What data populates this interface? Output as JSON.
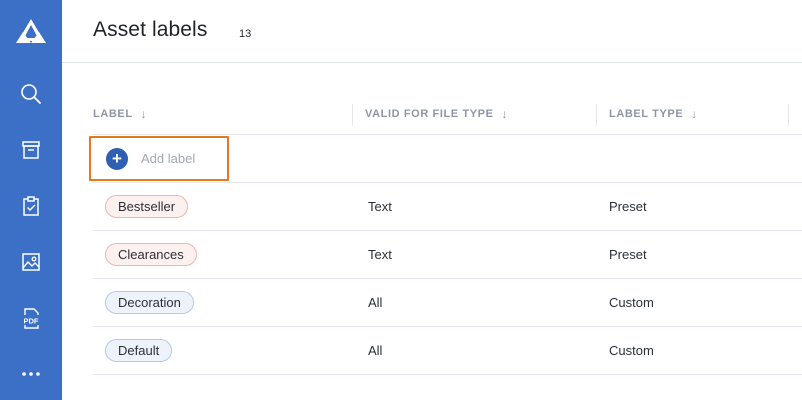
{
  "sidebar": {
    "items": [
      {
        "icon": "logo-icon"
      },
      {
        "icon": "search-icon"
      },
      {
        "icon": "archive-box-icon"
      },
      {
        "icon": "clipboard-check-icon"
      },
      {
        "icon": "image-icon"
      },
      {
        "icon": "pdf-icon",
        "label": "PDF"
      },
      {
        "icon": "more-icon"
      }
    ],
    "color": "#3c6fc6"
  },
  "header": {
    "title": "Asset labels",
    "count": "13"
  },
  "table": {
    "columns": [
      {
        "label": "LABEL",
        "sort_icon": "↓"
      },
      {
        "label": "VALID FOR FILE TYPE",
        "sort_icon": "↓"
      },
      {
        "label": "LABEL TYPE",
        "sort_icon": "↓"
      }
    ],
    "add_label": "Add label",
    "add_icon": "+",
    "rows": [
      {
        "label": "Bestseller",
        "file_type": "Text",
        "label_type": "Preset",
        "color": "red"
      },
      {
        "label": "Clearances",
        "file_type": "Text",
        "label_type": "Preset",
        "color": "red"
      },
      {
        "label": "Decoration",
        "file_type": "All",
        "label_type": "Custom",
        "color": "blue"
      },
      {
        "label": "Default",
        "file_type": "All",
        "label_type": "Custom",
        "color": "blue"
      }
    ]
  },
  "colors": {
    "accent": "#2f5fb3",
    "highlight": "#e07b22"
  }
}
